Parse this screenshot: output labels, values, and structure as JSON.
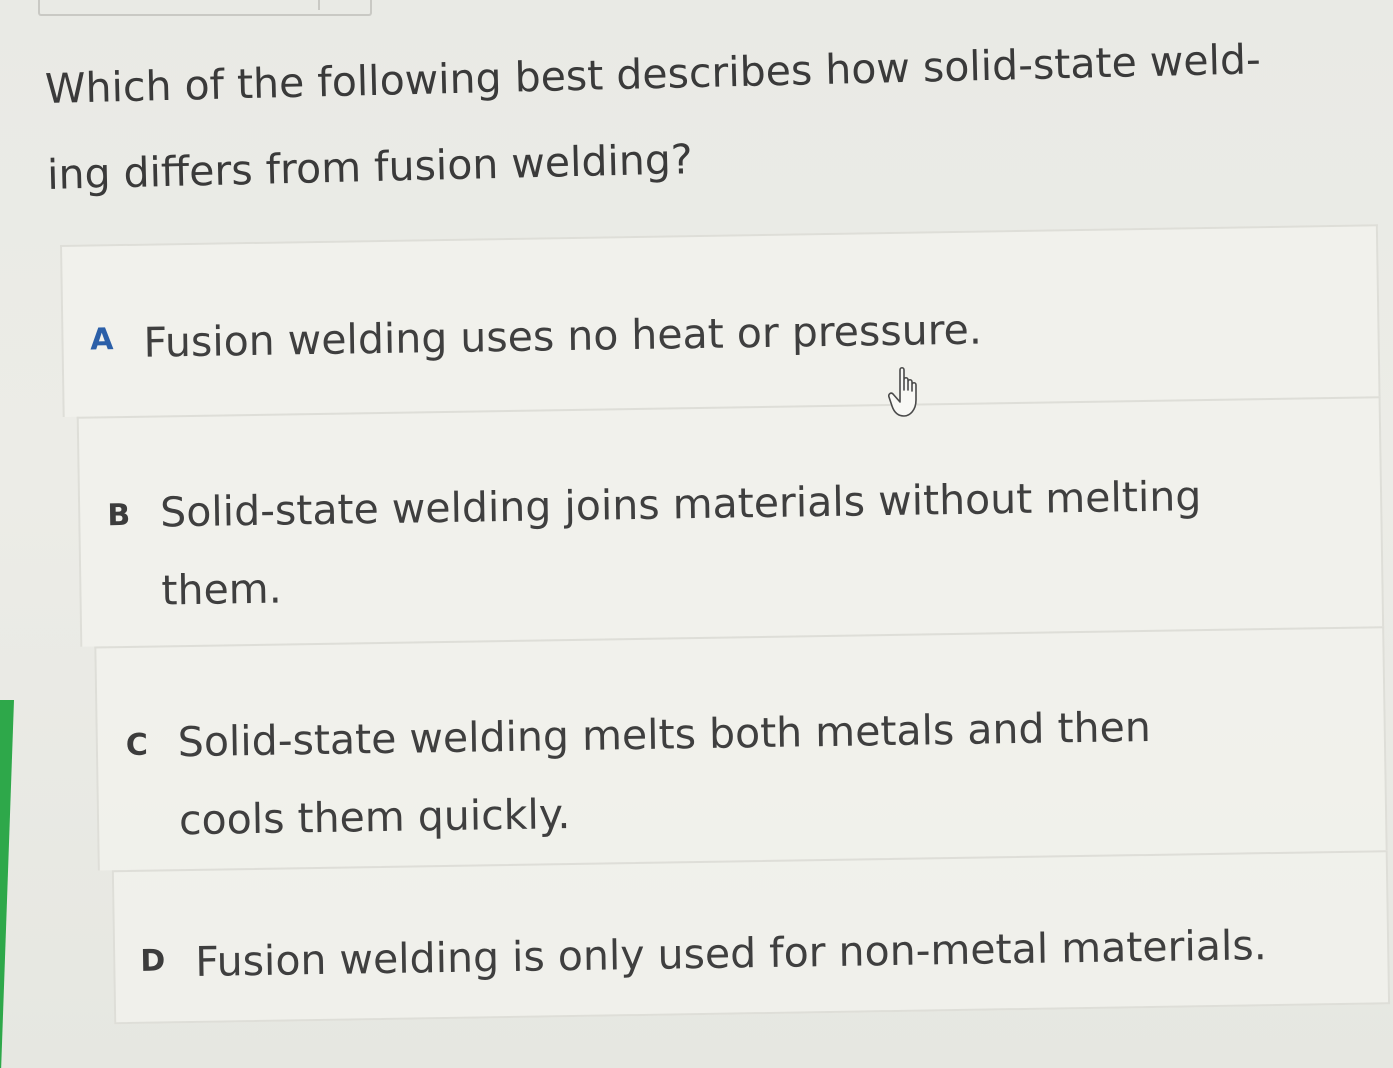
{
  "question": {
    "text": "Which of the following best describes how solid-state weld-ing differs from fusion welding?"
  },
  "options": [
    {
      "letter": "A",
      "text": "Fusion welding uses no heat or pressure."
    },
    {
      "letter": "B",
      "text": "Solid-state welding joins materials without melting them."
    },
    {
      "letter": "C",
      "text": "Solid-state welding melts both metals and then cools them quickly."
    },
    {
      "letter": "D",
      "text": "Fusion welding is only used for non-metal materials."
    }
  ],
  "cursor": {
    "icon": "hand-pointer-icon"
  },
  "colors": {
    "selected_letter": "#2b5fa8",
    "accent_bar": "#2ea84a"
  }
}
